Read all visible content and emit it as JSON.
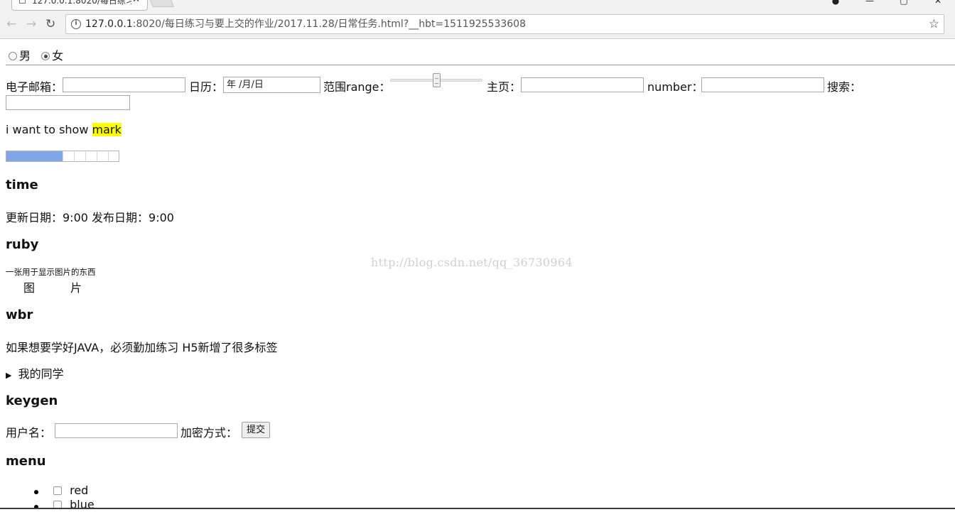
{
  "browser": {
    "tab_title": "127.0.0.1:8020/每日练习",
    "tab_close": "✕",
    "win_min": "—",
    "win_max": "▢",
    "win_close": "✕",
    "nav_back": "←",
    "nav_forward": "→",
    "nav_reload": "↻",
    "info_icon": "i",
    "url_host": "127.0.0.1",
    "url_rest": ":8020/每日练习与要上交的作业/2017.11.28/日常任务.html?__hbt=1511925533608",
    "star": "☆"
  },
  "gender": {
    "male_label": "男",
    "female_label": "女",
    "selected": "女"
  },
  "form": {
    "email_label": "电子邮箱：",
    "date_label": "日历：",
    "date_value": "年 /月/日",
    "range_label": "范围range：",
    "range_value": 0.5,
    "homepage_label": "主页：",
    "number_label": "number：",
    "search_label": "搜索："
  },
  "mark_line": {
    "prefix": "i want to show ",
    "marked": "mark"
  },
  "progress": {
    "value": 0.5
  },
  "time_section": {
    "heading": "time",
    "text": "更新日期：9:00 发布日期：9:00"
  },
  "ruby_section": {
    "heading": "ruby",
    "annotation": "一张用于显示图片的东西",
    "base_1": "图",
    "base_2": "片"
  },
  "wbr_section": {
    "heading": "wbr",
    "text": "如果想要学好JAVA，必须勤加练习 H5新增了很多标签"
  },
  "details": {
    "summary": "我的同学",
    "marker": "▶"
  },
  "keygen_section": {
    "heading": "keygen",
    "username_label": "用户名：",
    "encrypt_label": "加密方式：",
    "submit_label": "提交"
  },
  "menu_section": {
    "heading": "menu",
    "items": [
      "red",
      "blue"
    ]
  },
  "watermark": "http://blog.csdn.net/qq_36730964"
}
